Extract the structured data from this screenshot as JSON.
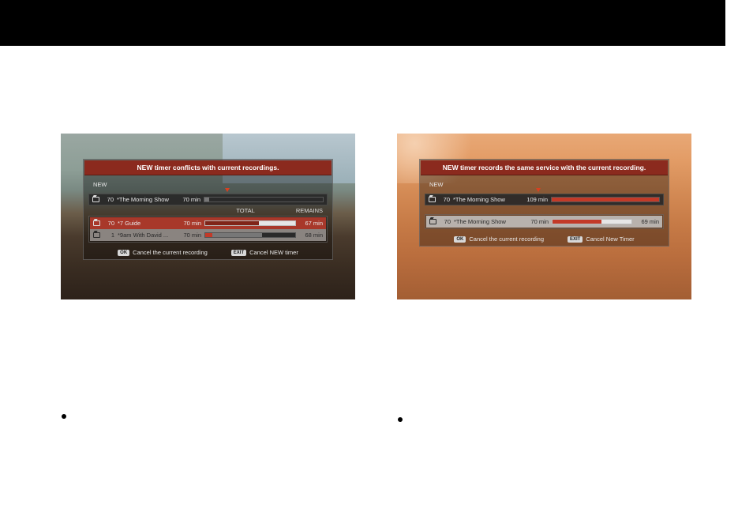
{
  "left": {
    "header": "NEW timer conflicts with current recordings.",
    "new_label": "NEW",
    "new_row": {
      "channel": "70",
      "name": "*The Morning Show",
      "duration": "70 min"
    },
    "th_total": "TOTAL",
    "th_remains": "REMAINS",
    "rows": [
      {
        "channel": "70",
        "name": "*7 Guide",
        "duration": "70 min",
        "remain": "67 min"
      },
      {
        "channel": "1",
        "name": "*9am With David ...",
        "duration": "70 min",
        "remain": "68 min"
      }
    ],
    "footer": {
      "ok_btn": "OK",
      "ok_label": "Cancel the current recording",
      "exit_btn": "EXIT",
      "exit_label": "Cancel NEW timer"
    }
  },
  "right": {
    "header": "NEW timer records the same service with the current recording.",
    "new_label": "NEW",
    "new_row": {
      "channel": "70",
      "name": "*The Morning Show",
      "duration": "109 min"
    },
    "row": {
      "channel": "70",
      "name": "*The Morning Show",
      "duration": "70 min",
      "remain": "69 min"
    },
    "footer": {
      "ok_btn": "OK",
      "ok_label": "Cancel the current recording",
      "exit_btn": "EXIT",
      "exit_label": "Cancel New Timer"
    }
  }
}
